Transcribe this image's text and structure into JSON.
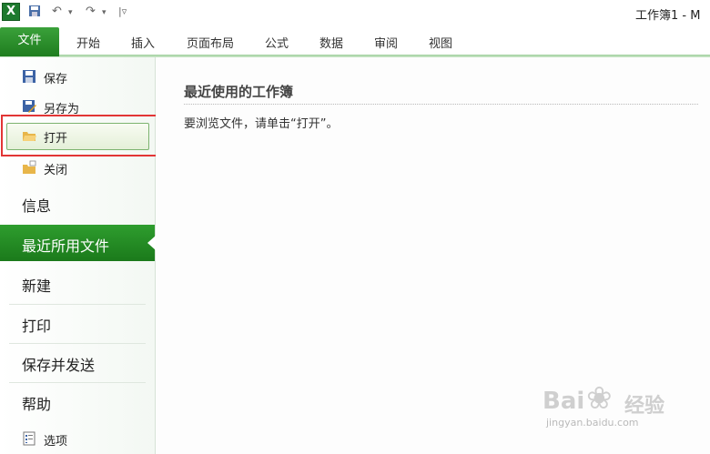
{
  "titlebar": {
    "title": "工作簿1 - M",
    "app_icon": "excel-icon",
    "quick_access": [
      "save-icon",
      "undo-icon",
      "redo-icon",
      "customize-icon"
    ]
  },
  "ribbon": {
    "file_tab": "文件",
    "tabs": [
      "开始",
      "插入",
      "页面布局",
      "公式",
      "数据",
      "审阅",
      "视图"
    ]
  },
  "backstage": {
    "commands": [
      {
        "label": "保存",
        "icon": "save-icon"
      },
      {
        "label": "另存为",
        "icon": "save-as-icon"
      },
      {
        "label": "打开",
        "icon": "open-folder-icon"
      },
      {
        "label": "关闭",
        "icon": "close-folder-icon"
      }
    ],
    "sections": [
      "信息",
      "最近所用文件",
      "新建",
      "打印",
      "保存并发送",
      "帮助"
    ],
    "active_section": "最近所用文件",
    "options": {
      "label": "选项",
      "icon": "options-icon"
    }
  },
  "main": {
    "heading": "最近使用的工作簿",
    "hint": "要浏览文件，请单击“打开”。"
  },
  "watermark": {
    "brand_left": "Bai",
    "brand_right": "经验",
    "url": "jingyan.baidu.com"
  },
  "colors": {
    "accent_green": "#1f7d1f",
    "highlight_red": "#e23535"
  }
}
